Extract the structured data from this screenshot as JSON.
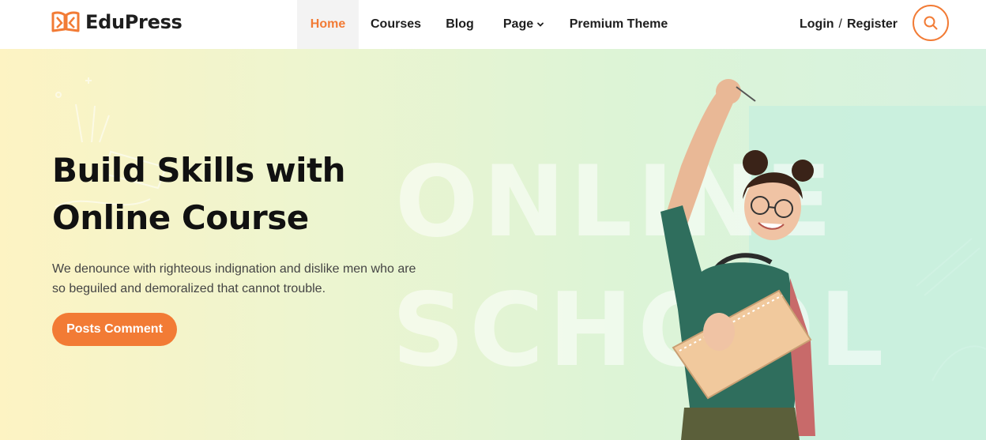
{
  "brand": {
    "name": "EduPress",
    "icon": "open-book-logo-icon",
    "color": "#f27b35"
  },
  "nav": {
    "items": [
      {
        "label": "Home",
        "active": true
      },
      {
        "label": "Courses",
        "active": false
      },
      {
        "label": "Blog",
        "active": false
      },
      {
        "label": "Page",
        "active": false,
        "icon": "chevron-down-icon"
      },
      {
        "label": "Premium Theme",
        "active": false
      }
    ]
  },
  "auth": {
    "login": "Login",
    "separator": "/",
    "register": "Register"
  },
  "search": {
    "icon": "search-icon"
  },
  "hero": {
    "title_line1": "Build Skills with",
    "title_line2": "Online Course",
    "description": "We denounce with righteous indignation and dislike men who are so beguiled and demoralized that cannot trouble.",
    "cta_label": "Posts Comment",
    "background_words": [
      "ONLINE",
      "SCHOOL"
    ],
    "image": "student-with-notebook-illustration"
  },
  "colors": {
    "accent": "#f27b35",
    "text_dark": "#111111",
    "text_body": "#444444"
  }
}
